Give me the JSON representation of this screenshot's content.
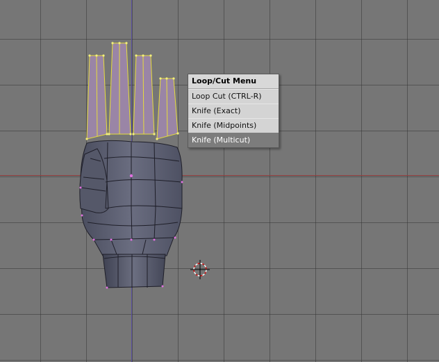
{
  "menu": {
    "title": "Loop/Cut Menu",
    "items": [
      {
        "label": "Loop Cut (CTRL-R)",
        "selected": false
      },
      {
        "label": "Knife (Exact)",
        "selected": false
      },
      {
        "label": "Knife (Midpoints)",
        "selected": false
      },
      {
        "label": "Knife (Multicut)",
        "selected": true
      }
    ]
  },
  "colors": {
    "viewport": "#767676",
    "grid": "#3a3a3a",
    "x_axis": "#8f3b3b",
    "y_axis": "#5a4fa0",
    "mesh_face": "#5f6273",
    "selected_face": "#9a85a6",
    "selected_edge": "#e6dc3c",
    "vertex": "#e070e0"
  }
}
